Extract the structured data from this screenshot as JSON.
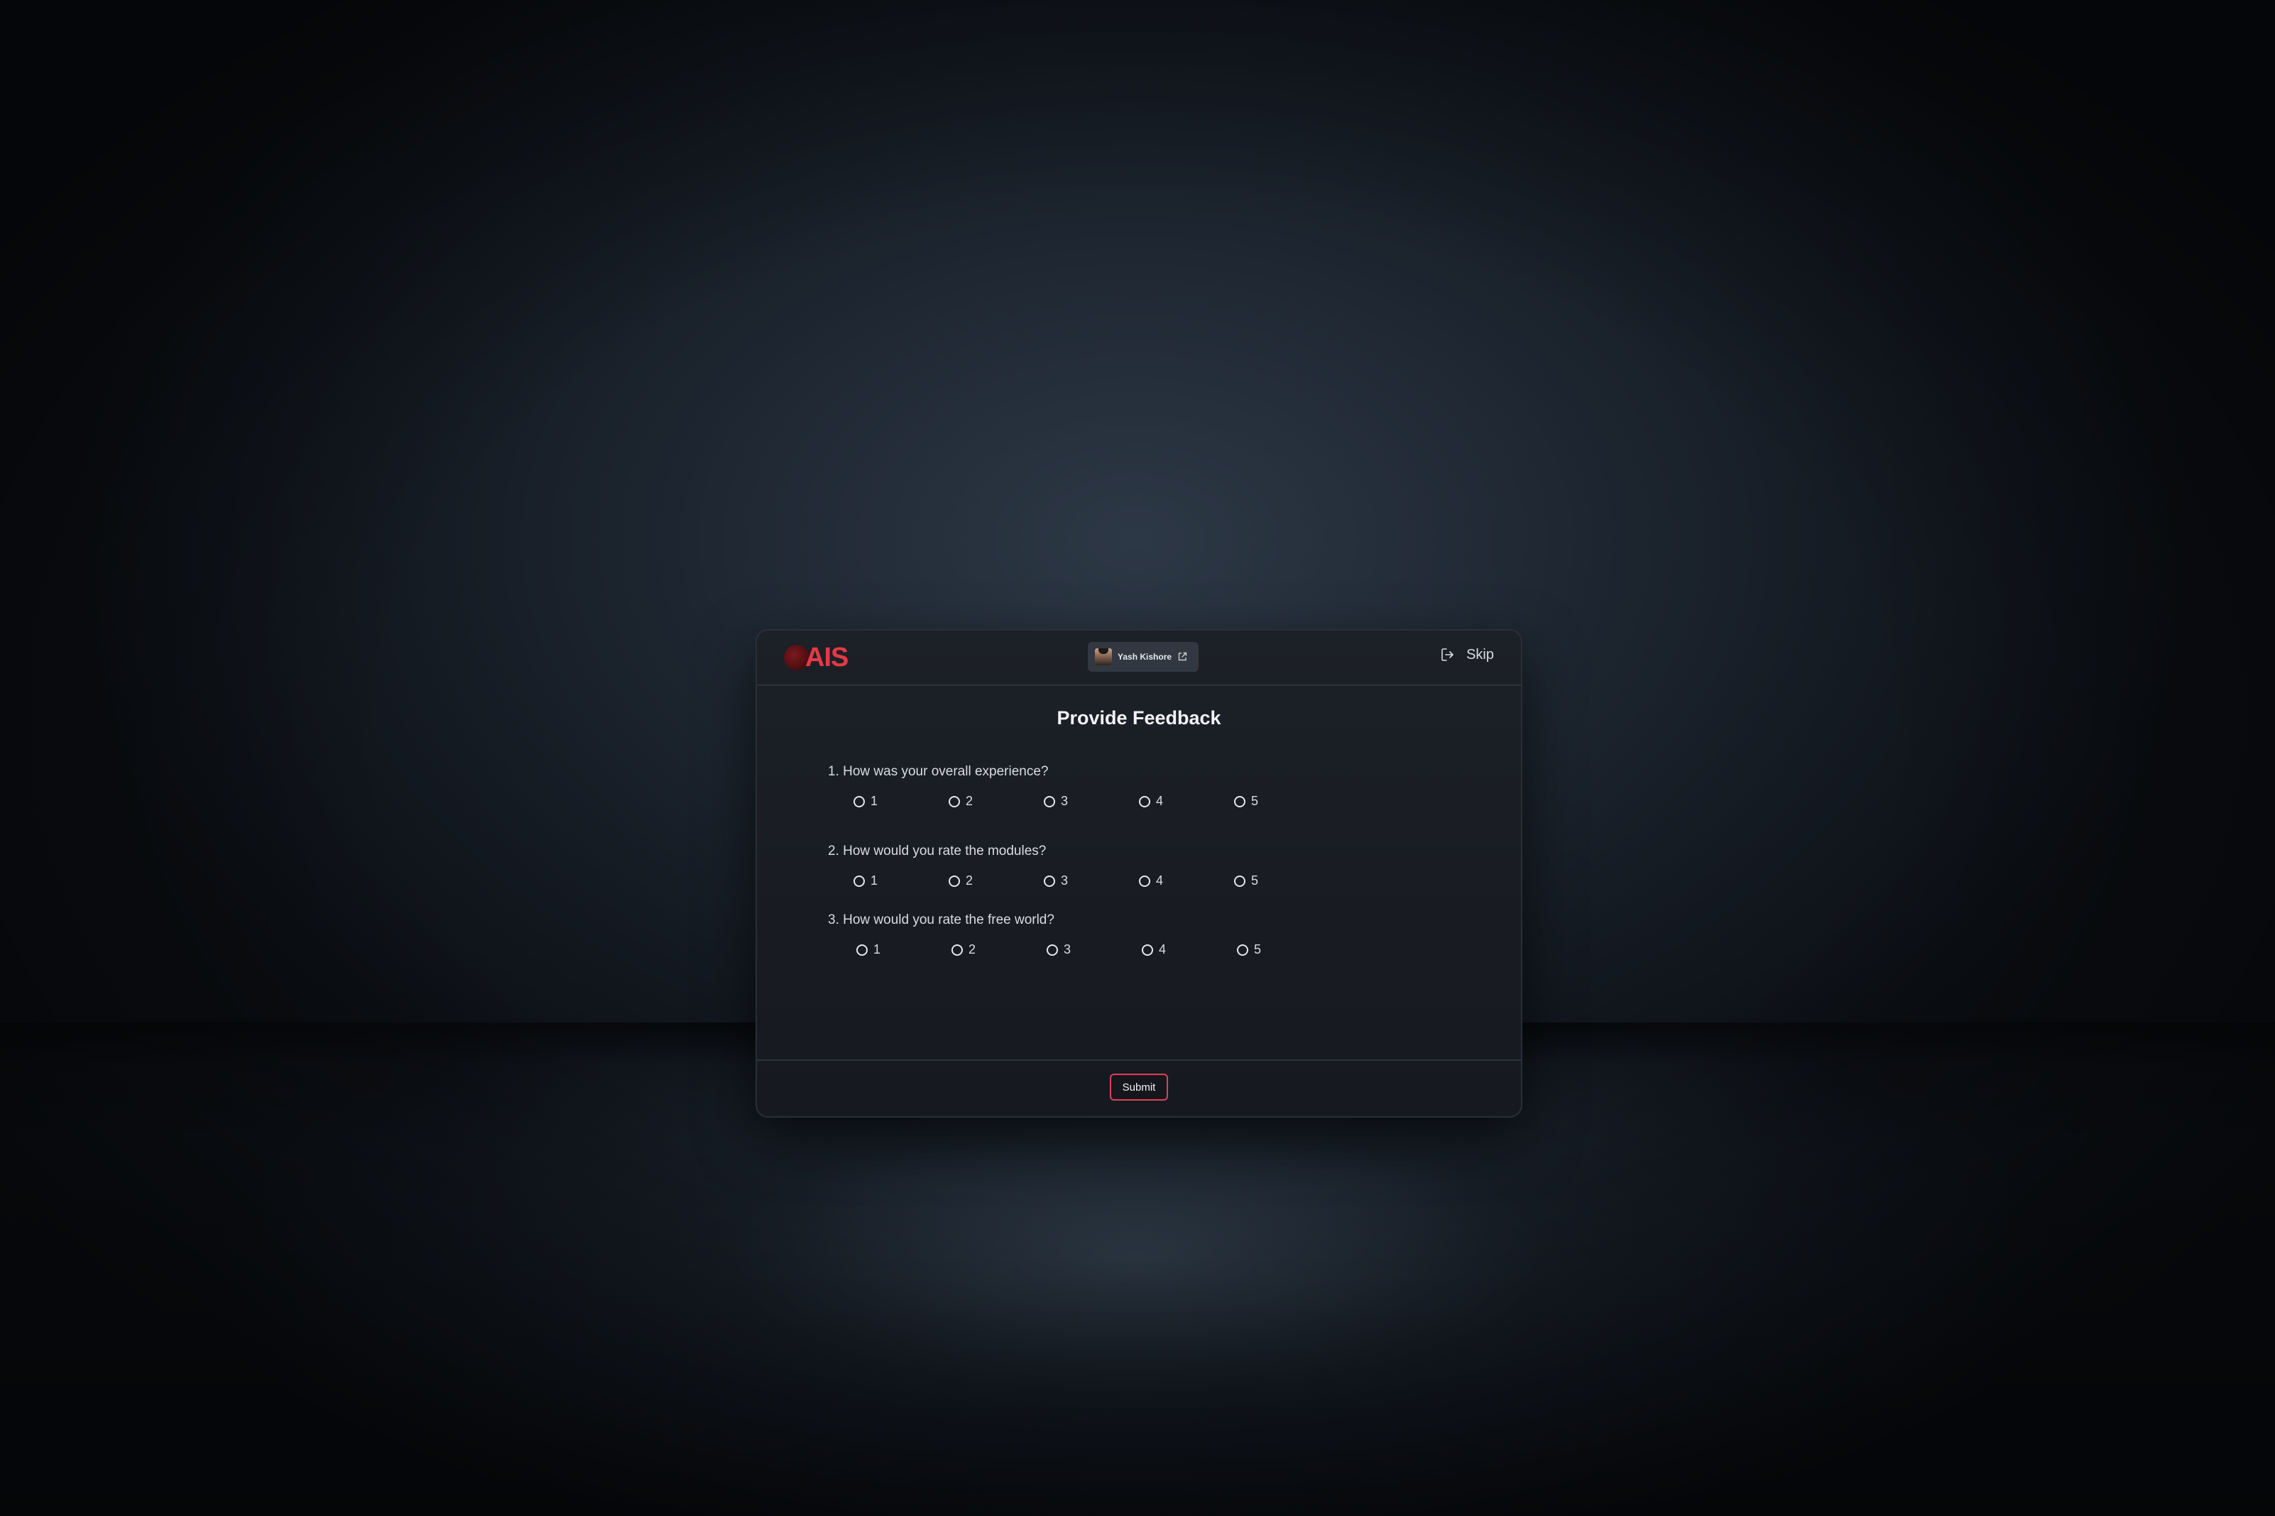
{
  "header": {
    "logo_text": "AIS",
    "user_name": "Yash Kishore",
    "skip_label": "Skip"
  },
  "title": "Provide Feedback",
  "questions": [
    {
      "text": "1. How was your overall experience?",
      "options": [
        "1",
        "2",
        "3",
        "4",
        "5"
      ]
    },
    {
      "text": "2. How would you rate the modules?",
      "options": [
        "1",
        "2",
        "3",
        "4",
        "5"
      ]
    },
    {
      "text": "3. How would you rate the free world?",
      "options": [
        "1",
        "2",
        "3",
        "4",
        "5"
      ]
    }
  ],
  "footer": {
    "submit_label": "Submit"
  },
  "colors": {
    "brand": "#e63946",
    "submit_border": "#e0405a"
  },
  "icons": {
    "logo": "ais-logo-icon",
    "user_link": "external-link-icon",
    "skip": "logout-icon"
  }
}
